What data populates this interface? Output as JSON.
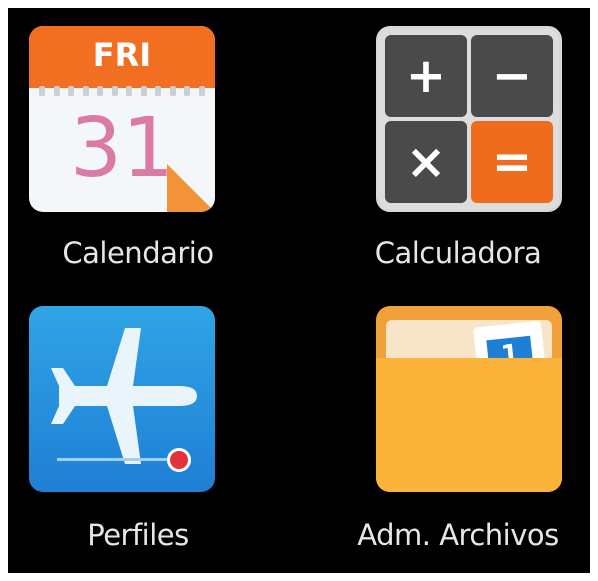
{
  "apps": [
    {
      "label": "Calendario",
      "icon": "calendar-icon",
      "day_name": "FRI",
      "day_number": "31"
    },
    {
      "label": "Calculadora",
      "icon": "calculator-icon",
      "keys": [
        "+",
        "−",
        "×",
        "="
      ]
    },
    {
      "label": "Perfiles",
      "icon": "airplane-icon"
    },
    {
      "label": "Adm. Archivos",
      "icon": "folder-icon",
      "badge": "1"
    }
  ],
  "colors": {
    "background": "#000000",
    "calendar_header": "#f26f21",
    "calendar_day": "#d97ba4",
    "calculator_key": "#4a4a4a",
    "calculator_accent": "#ef6c1e",
    "profiles_blue": "#1f7fd4",
    "folder_orange": "#fbb33a",
    "label": "#e6e6e6"
  }
}
